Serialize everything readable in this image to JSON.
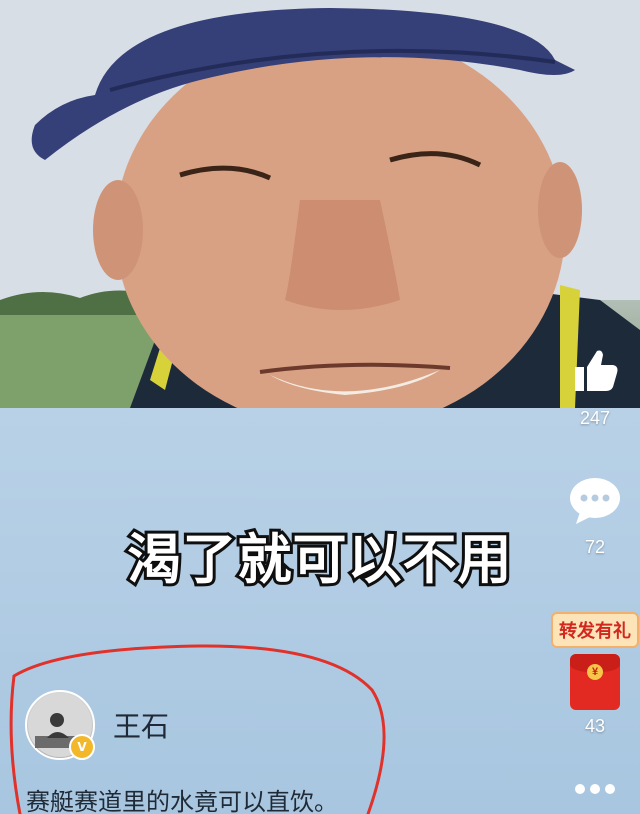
{
  "video": {
    "caption": "渴了就可以不用"
  },
  "rail": {
    "like_icon": "thumbs-up-icon",
    "like_count": "247",
    "comment_icon": "chat-bubble-icon",
    "comment_count": "72",
    "gift_label": "转发有礼",
    "gift_icon": "red-packet-icon",
    "gift_count": "43",
    "more_icon": "more-dots-icon"
  },
  "author": {
    "name": "王石",
    "verified_icon": "verified-v-icon"
  },
  "post": {
    "description": "赛艇赛道里的水竟可以直饮。"
  },
  "colors": {
    "annotation_circle": "#e0322b",
    "badge_red": "#d2271f",
    "verified_gold": "#f3b72a"
  }
}
